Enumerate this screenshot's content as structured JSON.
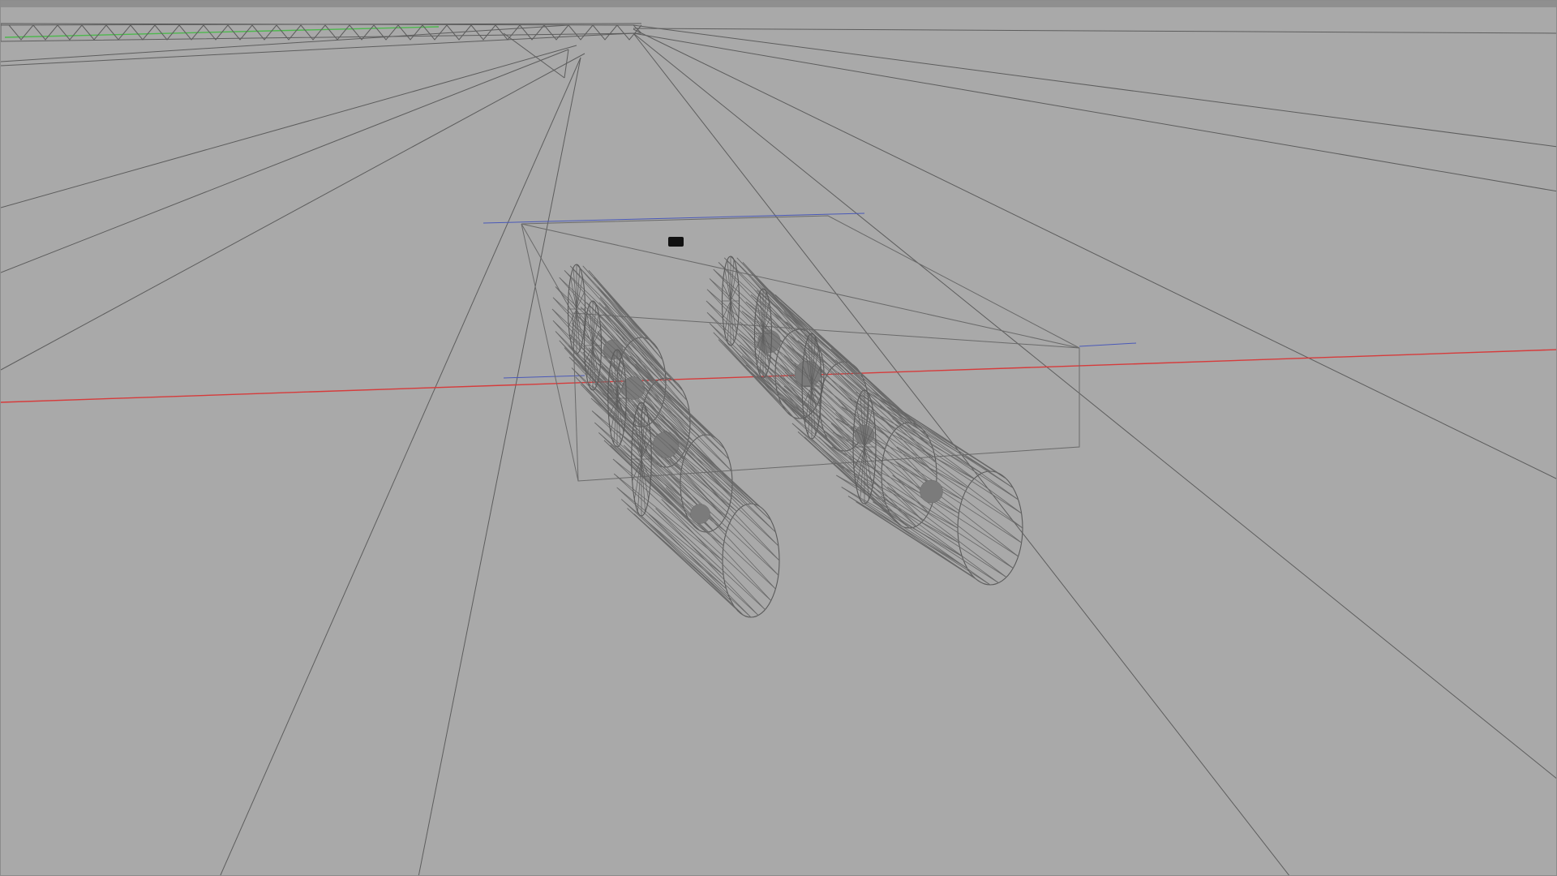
{
  "viewport": {
    "background": "#a9a9a9",
    "top_bar_color": "#8f8f8f"
  },
  "axes": {
    "x_axis_color": "#d63b3b",
    "y_axis_color": "#4db84d",
    "z_axis_color": "#4a59b8"
  },
  "scene": {
    "wheel_count": 8,
    "wheel_color": "#5a5a5a",
    "hub_color": "#7b7b7b",
    "sensor_color": "#111111"
  }
}
